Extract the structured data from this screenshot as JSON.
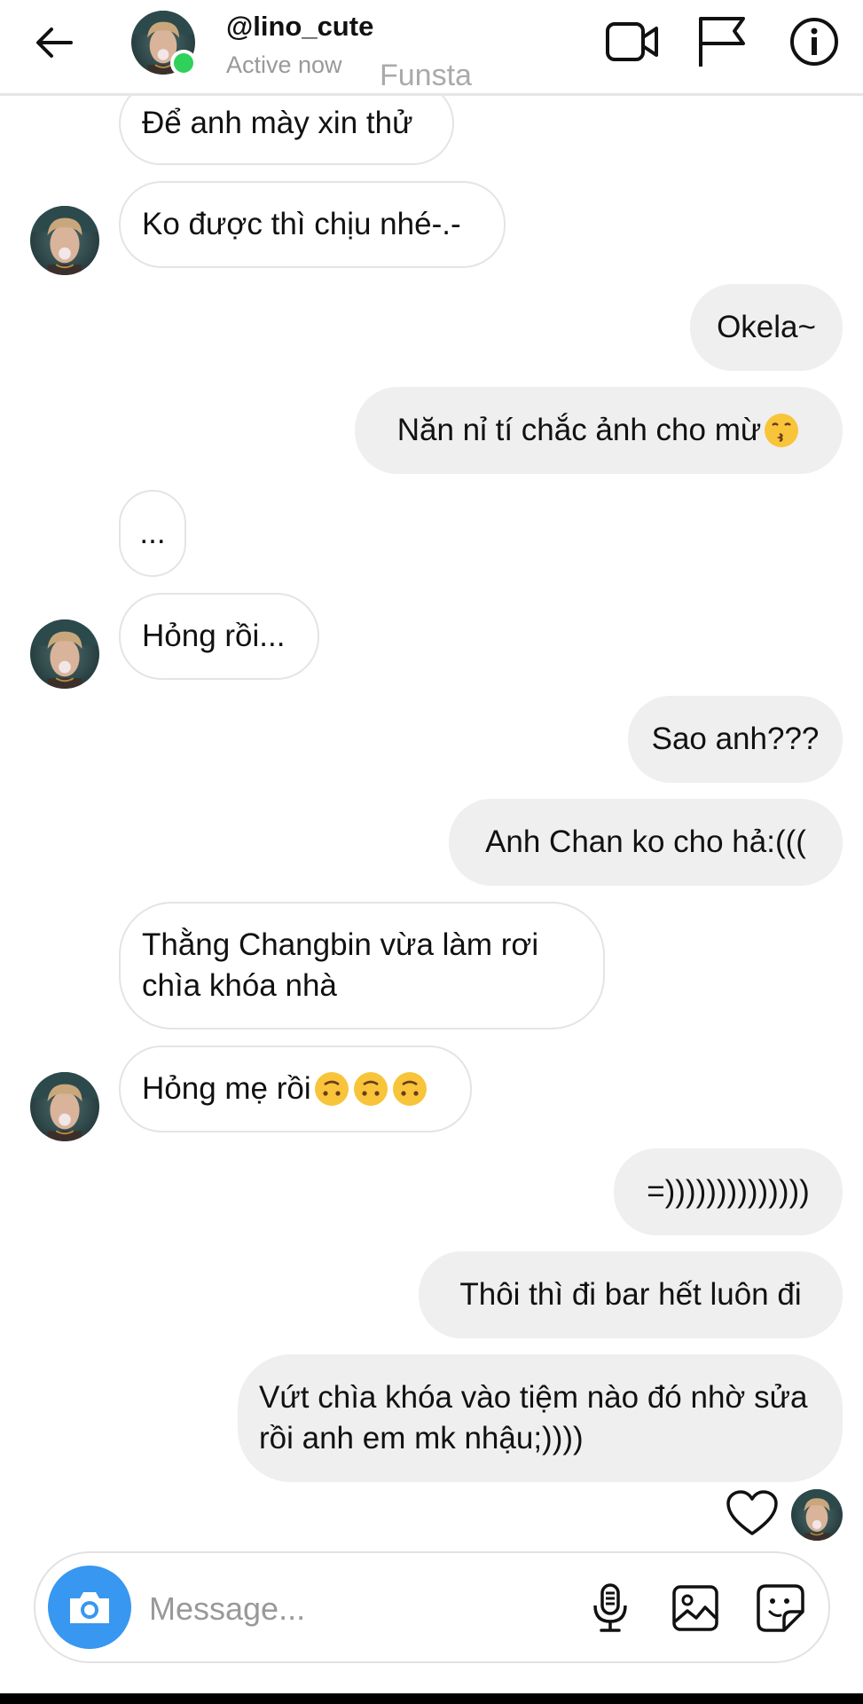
{
  "header": {
    "username": "@lino_cute",
    "status": "Active now",
    "tag": "Funsta"
  },
  "messages": [
    {
      "text": "Để anh mày xin thử"
    },
    {
      "text": "Ko được thì chịu nhé-.-"
    },
    {
      "text": "Okela~"
    },
    {
      "text": "Năn nỉ tí chắc ảnh cho mừ"
    },
    {
      "text": "..."
    },
    {
      "text": "Hỏng rồi..."
    },
    {
      "text": "Sao anh???"
    },
    {
      "text": "Anh Chan ko cho hả:((("
    },
    {
      "text": "Thằng Changbin vừa làm rơi chìa khóa nhà"
    },
    {
      "text": "Hỏng mẹ rồi"
    },
    {
      "text": "=))))))))))))))"
    },
    {
      "text": "Thôi thì đi bar hết luôn đi"
    },
    {
      "text": "Vứt chìa khóa vào tiệm nào đó nhờ sửa rồi anh em mk nhậu;))))"
    }
  ],
  "composer": {
    "placeholder": "Message..."
  },
  "icons": {
    "back": "arrow-left-icon",
    "video": "video-camera-icon",
    "flag": "flag-icon",
    "info": "info-icon",
    "camera": "camera-icon",
    "mic": "microphone-icon",
    "gallery": "image-icon",
    "sticker": "sticker-icon",
    "heart": "heart-icon",
    "emoji_kiss": "kissing-face-icon",
    "emoji_upside": "upside-down-face-icon"
  },
  "colors": {
    "accent": "#3897f0",
    "active": "#2fd15a",
    "outgoing_bubble": "#efefef",
    "incoming_border": "#e4e4e4"
  }
}
